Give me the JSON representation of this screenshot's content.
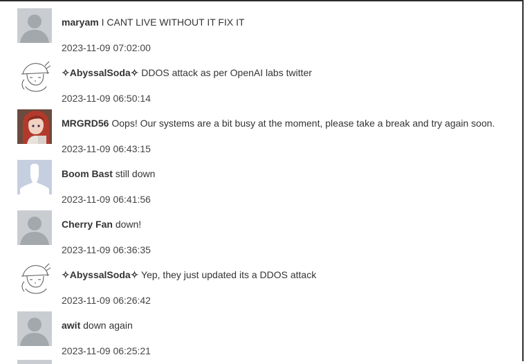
{
  "comments": [
    {
      "author": "maryam",
      "text": "I CANT LIVE WITHOUT IT FIX IT",
      "timestamp": "2023-11-09 07:02:00",
      "avatar": "default-user-icon"
    },
    {
      "author": "✧AbyssalSoda✧",
      "text": "DDOS attack as per OpenAI labs twitter",
      "timestamp": "2023-11-09 06:50:14",
      "avatar": "sketch-character-avatar"
    },
    {
      "author": "MRGRD56",
      "text": "Oops! Our systems are a bit busy at the moment, please take a break and try again soon.",
      "timestamp": "2023-11-09 06:43:15",
      "avatar": "anime-character-avatar"
    },
    {
      "author": "Boom Bast",
      "text": "still down",
      "timestamp": "2023-11-09 06:41:56",
      "avatar": "silhouette-user-icon"
    },
    {
      "author": "Cherry Fan",
      "text": "down!",
      "timestamp": "2023-11-09 06:36:35",
      "avatar": "default-user-icon"
    },
    {
      "author": "✧AbyssalSoda✧",
      "text": "Yep, they just updated its a DDOS attack",
      "timestamp": "2023-11-09 06:26:42",
      "avatar": "sketch-character-avatar"
    },
    {
      "author": "awit",
      "text": "down again",
      "timestamp": "2023-11-09 06:25:21",
      "avatar": "default-user-icon"
    }
  ],
  "colors": {
    "default_avatar_bg": "#c9cdd1",
    "default_avatar_fg": "#a3a8ad",
    "silhouette_bg": "#c5cfe0",
    "silhouette_fg": "#ffffff",
    "anime_hair": "#b23a2c"
  }
}
